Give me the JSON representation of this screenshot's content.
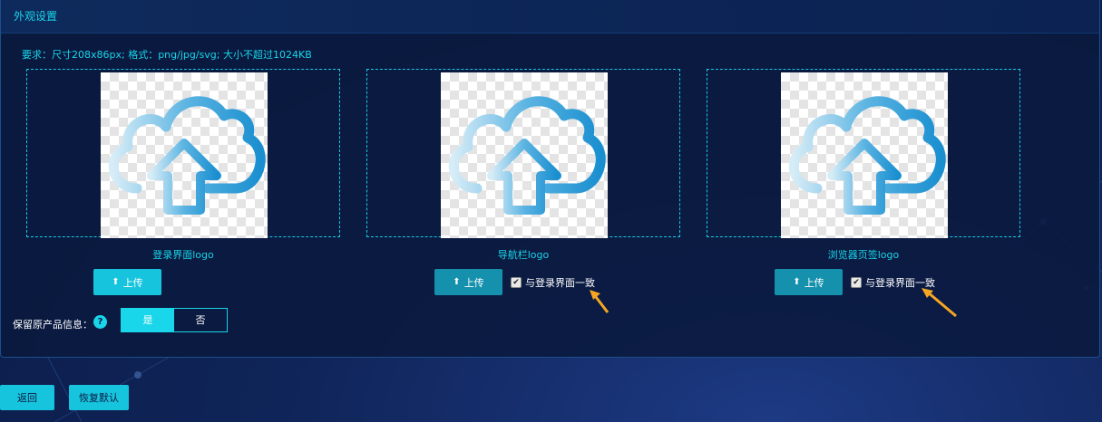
{
  "panel": {
    "title": "外观设置"
  },
  "requirement": "要求：尺寸208x86px; 格式：png/jpg/svg; 大小不超过1024KB",
  "logos": [
    {
      "label": "登录界面logo",
      "upload_label": "上传",
      "same_label": ""
    },
    {
      "label": "导航栏logo",
      "upload_label": "上传",
      "same_label": "与登录界面一致",
      "same_checked": true
    },
    {
      "label": "浏览器页签logo",
      "upload_label": "上传",
      "same_label": "与登录界面一致",
      "same_checked": true
    }
  ],
  "keep_info": {
    "label": "保留原产品信息：",
    "help": "?",
    "options": [
      "是",
      "否"
    ],
    "selected": "是"
  },
  "footer": {
    "back_label": "返回",
    "reset_label": "恢复默认"
  },
  "colors": {
    "accent": "#19d6ea",
    "button_secondary": "#1591ad",
    "arrow": "#f5a623"
  },
  "icons": {
    "upload": "upload-icon",
    "help": "help-icon",
    "checkbox": "checkbox-icon",
    "cloud": "cloud-upload-icon"
  }
}
